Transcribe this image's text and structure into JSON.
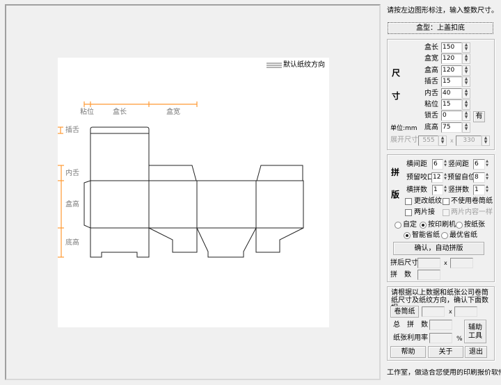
{
  "canvas": {
    "legend": "默认纸纹方向",
    "dims_h": {
      "glue": "粘位",
      "length": "盒长",
      "width": "盒宽"
    },
    "dims_v": {
      "tuck": "插舌",
      "inner": "内舌",
      "height": "盒高",
      "bottom": "底高"
    },
    "accent_color": "#ff9933"
  },
  "side": {
    "instruction": "请按左边图形标注，输入整数尺寸。",
    "box_type_button": "盒型：上盖扣底",
    "size": {
      "title_1": "尺",
      "title_2": "寸",
      "unit": "单位:mm",
      "fields": [
        {
          "label": "盒长",
          "value": "150"
        },
        {
          "label": "盒宽",
          "value": "120"
        },
        {
          "label": "盒高",
          "value": "120"
        },
        {
          "label": "插舌",
          "value": "15"
        },
        {
          "label": "内舌",
          "value": "40"
        },
        {
          "label": "粘位",
          "value": "15"
        },
        {
          "label": "锁舌",
          "value": "0"
        },
        {
          "label": "底高",
          "value": "75"
        }
      ],
      "lock_button": "有",
      "unfold_label": "展开尺寸",
      "unfold_w": "555",
      "unfold_x": "x",
      "unfold_h": "330"
    },
    "layout": {
      "title_1": "拼",
      "title_2": "版",
      "h_gap_label": "横间距",
      "h_gap": "6",
      "v_gap_label": "竖间距",
      "v_gap": "6",
      "bite_label": "预留咬口",
      "bite": "12",
      "margin_label": "预留自位",
      "margin": "8",
      "h_count_label": "横拼数",
      "h_count": "1",
      "v_count_label": "竖拼数",
      "v_count": "1",
      "cb_grain": "更改纸纹",
      "cb_noroll": "不使用卷筒纸",
      "cb_twopiece": "两片接",
      "cb_same": "两片内容一样",
      "r_custom": "自定",
      "r_press": "按印刷机",
      "r_paper": "按纸张",
      "r_smart": "智能省纸",
      "r_best": "最优省纸",
      "confirm_button": "确认，自动拼版",
      "after_size_label": "拼后尺寸",
      "x": "x",
      "count_label": "拼　数"
    },
    "roll": {
      "note": "请根据以上数据和纸张公司卷筒纸尺寸及纸纹方向，确认下面数据",
      "roll_button": "卷筒纸",
      "x": "x",
      "total_label": "总　拼　数",
      "usage_label": "纸张利用率",
      "percent": "%",
      "tools_button": "辅助工具",
      "help_button": "帮助",
      "about_button": "关于",
      "exit_button": "退出"
    },
    "status": "工作室，做适合您使用的印刷报价软件"
  }
}
